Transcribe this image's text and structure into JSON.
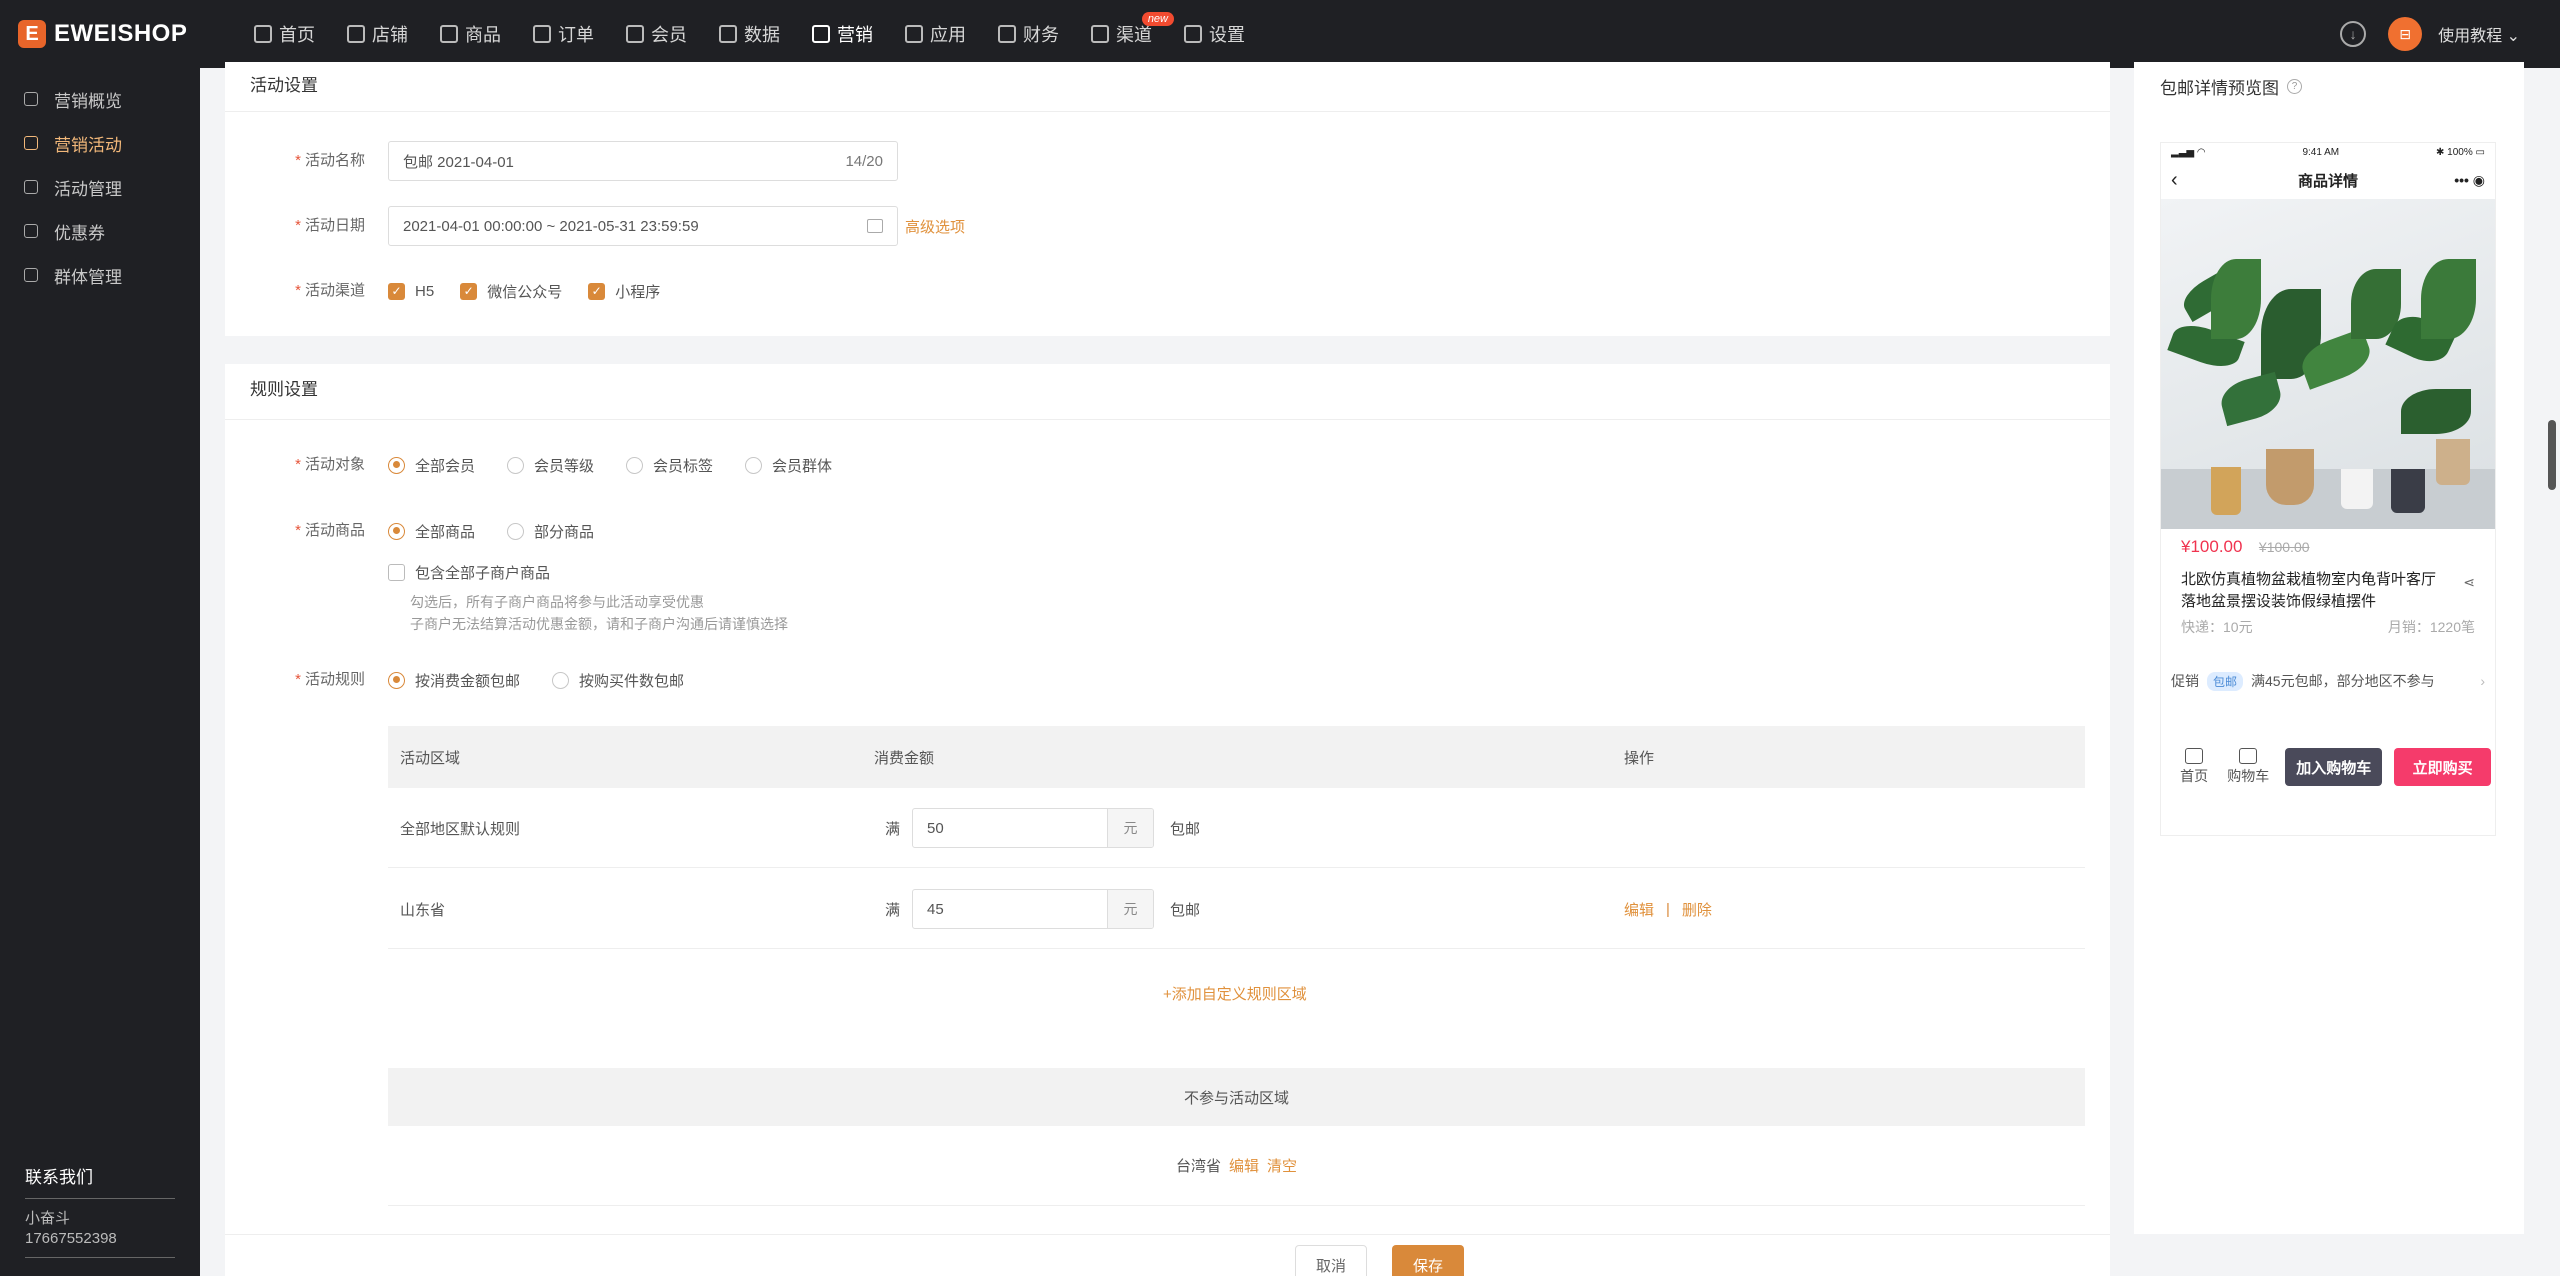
{
  "brand": {
    "logo_mark": "E",
    "name": "EWEISHOP"
  },
  "nav": [
    {
      "label": "首页",
      "icon": "home-icon"
    },
    {
      "label": "店铺",
      "icon": "shop-icon"
    },
    {
      "label": "商品",
      "icon": "goods-icon"
    },
    {
      "label": "订单",
      "icon": "order-icon"
    },
    {
      "label": "会员",
      "icon": "member-icon"
    },
    {
      "label": "数据",
      "icon": "data-icon"
    },
    {
      "label": "营销",
      "icon": "tag-icon",
      "active": true
    },
    {
      "label": "应用",
      "icon": "app-icon"
    },
    {
      "label": "财务",
      "icon": "finance-icon"
    },
    {
      "label": "渠道",
      "icon": "channel-icon",
      "badge": "new"
    },
    {
      "label": "设置",
      "icon": "gear-icon"
    }
  ],
  "topright": {
    "avatar": "⊟",
    "help_label": "使用教程 ⌄"
  },
  "sidebar": {
    "items": [
      {
        "label": "营销概览"
      },
      {
        "label": "营销活动",
        "active": true
      },
      {
        "label": "活动管理"
      },
      {
        "label": "优惠券"
      },
      {
        "label": "群体管理"
      }
    ],
    "contact_title": "联系我们",
    "contact_name": "小奋斗",
    "contact_phone": "17667552398"
  },
  "activity": {
    "section_title": "活动设置",
    "name_label": "活动名称",
    "name_value": "包邮 2021-04-01",
    "name_count": "14/20",
    "date_label": "活动日期",
    "date_value": "2021-04-01 00:00:00 ~ 2021-05-31 23:59:59",
    "advanced_label": "高级选项",
    "channel_label": "活动渠道",
    "channels": [
      "H5",
      "微信公众号",
      "小程序"
    ]
  },
  "rules": {
    "section_title": "规则设置",
    "target_label": "活动对象",
    "targets": [
      "全部会员",
      "会员等级",
      "会员标签",
      "会员群体"
    ],
    "goods_label": "活动商品",
    "goods": [
      "全部商品",
      "部分商品"
    ],
    "include_sub": "包含全部子商户商品",
    "hint1": "勾选后，所有子商户商品将参与此活动享受优惠",
    "hint2": "子商户无法结算活动优惠金额，请和子商户沟通后请谨慎选择",
    "rule_label": "活动规则",
    "rule_options": [
      "按消费金额包邮",
      "按购买件数包邮"
    ],
    "table_headers": [
      "活动区域",
      "消费金额",
      "操作"
    ],
    "rows": [
      {
        "region": "全部地区默认规则",
        "prefix": "满",
        "amount": "50",
        "unit": "元",
        "suffix": "包邮"
      },
      {
        "region": "山东省",
        "prefix": "满",
        "amount": "45",
        "unit": "元",
        "suffix": "包邮",
        "edit": "编辑",
        "sep": "|",
        "delete": "删除"
      }
    ],
    "add_region": "+添加自定义规则区域",
    "excluded_title": "不参与活动区域",
    "excluded_region": "台湾省",
    "excluded_edit": "编辑",
    "excluded_clear": "清空"
  },
  "footer": {
    "cancel": "取消",
    "save": "保存"
  },
  "preview": {
    "title": "包邮详情预览图",
    "time": "9:41 AM",
    "battery": "100%",
    "header": "商品详情",
    "price": "¥100.00",
    "old_price": "¥100.00",
    "product_title": "北欧仿真植物盆栽植物室内龟背叶客厅落地盆景摆设装饰假绿植摆件",
    "shipping": "快递：10元",
    "sales": "月销：1220笔",
    "promo_label": "促销",
    "promo_tag": "包邮",
    "promo_text": "满45元包邮，部分地区不参与",
    "tab_home": "首页",
    "tab_cart": "购物车",
    "add_cart": "加入购物车",
    "buy_now": "立即购买"
  },
  "colors": {
    "accent": "#d9893a",
    "topbar": "#1f2024",
    "price": "#f0334f",
    "buy": "#f53b6b",
    "cart_btn": "#4a4a5a"
  }
}
